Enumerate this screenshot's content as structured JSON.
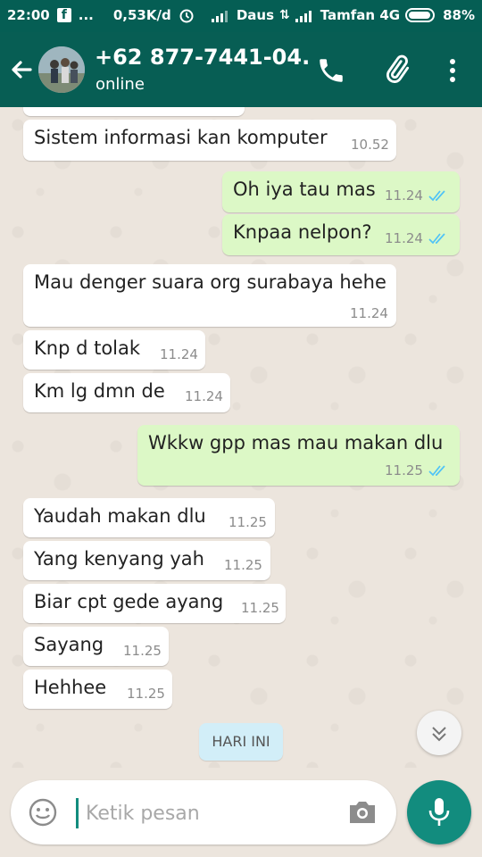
{
  "status_bar": {
    "time": "22:00",
    "notif_dots": "...",
    "speed": "0,53K/d",
    "carrier1": "Daus",
    "carrier2": "Tamfan 4G",
    "battery": "88%"
  },
  "header": {
    "contact_name": "+62 877-7441-04...",
    "contact_status": "online"
  },
  "messages": [
    {
      "dir": "in",
      "text": "Sistem informasi kan komputer",
      "time": "10.52"
    },
    {
      "dir": "out",
      "text": "Oh iya tau mas",
      "time": "11.24"
    },
    {
      "dir": "out",
      "text": "Knpaa nelpon?",
      "time": "11.24"
    },
    {
      "dir": "in",
      "text": "Mau denger suara org surabaya hehe",
      "time": "11.24"
    },
    {
      "dir": "in",
      "text": "Knp d tolak",
      "time": "11.24"
    },
    {
      "dir": "in",
      "text": "Km lg dmn de",
      "time": "11.24"
    },
    {
      "dir": "out",
      "text": "Wkkw gpp mas mau makan dlu",
      "time": "11.25"
    },
    {
      "dir": "in",
      "text": "Yaudah makan dlu",
      "time": "11.25"
    },
    {
      "dir": "in",
      "text": "Yang kenyang yah",
      "time": "11.25"
    },
    {
      "dir": "in",
      "text": "Biar cpt gede ayang",
      "time": "11.25"
    },
    {
      "dir": "in",
      "text": "Sayang",
      "time": "11.25"
    },
    {
      "dir": "in",
      "text": "Hehhee",
      "time": "11.25"
    }
  ],
  "date_divider": "HARI INI",
  "input": {
    "placeholder": "Ketik pesan"
  },
  "colors": {
    "header": "#075e54",
    "status_bar": "#055e54",
    "outgoing_bubble": "#dcf8c6",
    "incoming_bubble": "#ffffff",
    "read_ticks": "#4fc3f7",
    "accent": "#128c7e"
  },
  "icons": [
    "facebook-icon",
    "alarm-icon",
    "signal-icon",
    "battery-icon",
    "back-arrow-icon",
    "phone-icon",
    "paperclip-icon",
    "more-vert-icon",
    "double-check-icon",
    "chevron-down-icon",
    "emoji-icon",
    "camera-icon",
    "mic-icon"
  ]
}
